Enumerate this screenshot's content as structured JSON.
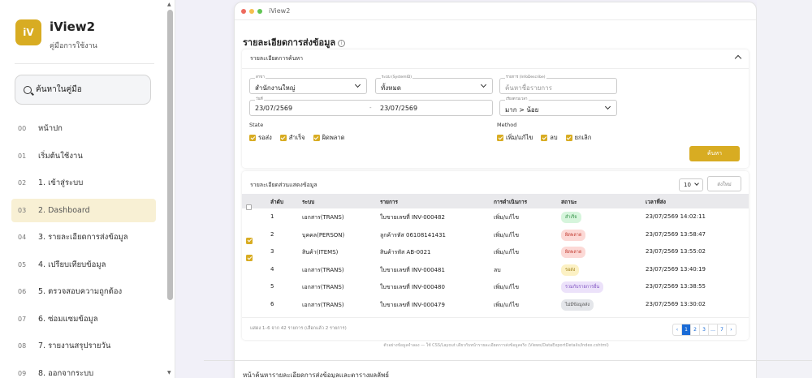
{
  "sidebar": {
    "logo_text": "iV",
    "app_name": "iView2",
    "app_subtitle": "คู่มือการใช้งาน",
    "search_placeholder": "ค้นหาในคู่มือ",
    "items": [
      {
        "num": "00",
        "label": "หน้าปก"
      },
      {
        "num": "01",
        "label": "เริ่มต้นใช้งาน"
      },
      {
        "num": "02",
        "label": "1. เข้าสู่ระบบ"
      },
      {
        "num": "03",
        "label": "2. Dashboard",
        "active": true
      },
      {
        "num": "04",
        "label": "3. รายละเอียดการส่งข้อมูล"
      },
      {
        "num": "05",
        "label": "4. เปรียบเทียบข้อมูล"
      },
      {
        "num": "06",
        "label": "5. ตรวจสอบความถูกต้อง"
      },
      {
        "num": "07",
        "label": "6. ซ่อมแซมข้อมูล"
      },
      {
        "num": "08",
        "label": "7. รายงานสรุปรายวัน"
      },
      {
        "num": "09",
        "label": "8. ออกจากระบบ"
      }
    ]
  },
  "window": {
    "title": "iView2",
    "dots": [
      "#ed6a5e",
      "#f5bf4f",
      "#61c554"
    ]
  },
  "page": {
    "title": "รายละเอียดการส่งข้อมูล",
    "info_icon": "i"
  },
  "filter": {
    "card_title": "รายละเอียดการค้นหา",
    "branch": {
      "label": "สาขา",
      "value": "สำนักงานใหญ่"
    },
    "system": {
      "label": "ระบบ (SystemID)",
      "value": "ทั้งหมด"
    },
    "item": {
      "label": "รายการ (InfoDescribe)",
      "placeholder": "ค้นหาชื่อรายการ"
    },
    "date": {
      "label": "วันที่",
      "from": "23/07/2569",
      "sep": "-",
      "to": "23/07/2569"
    },
    "sort": {
      "label": "เรียงตามเวลา",
      "value": "มาก > น้อย"
    },
    "state_label": "State",
    "states": [
      "รอส่ง",
      "สำเร็จ",
      "ผิดพลาด"
    ],
    "method_label": "Method",
    "methods": [
      "เพิ่ม/แก้ไข",
      "ลบ",
      "ยกเลิก"
    ],
    "search_button": "ค้นหา"
  },
  "table": {
    "title": "รายละเอียดส่วนแสดงข้อมูล",
    "page_size": "10",
    "export_button": "ส่งใหม่",
    "columns": [
      "ลำดับ",
      "ระบบ",
      "รายการ",
      "การดำเนินการ",
      "สถานะ",
      "เวลาที่ส่ง"
    ],
    "rows": [
      {
        "no": "1",
        "system": "เอกสาร(TRANS)",
        "item": "ใบขายเลขที่ INV-000482",
        "action": "เพิ่ม/แก้ไข",
        "status": "สำเร็จ",
        "status_bg": "#d6f5dc",
        "status_fg": "#2a8a3e",
        "time": "23/07/2569 14:02:11",
        "checked": false
      },
      {
        "no": "2",
        "system": "บุคคล(PERSON)",
        "item": "ลูกค้ารหัส 06108141431",
        "action": "เพิ่ม/แก้ไข",
        "status": "ผิดพลาด",
        "status_bg": "#fcd9d6",
        "status_fg": "#c23b30",
        "time": "23/07/2569 13:58:47",
        "checked": true
      },
      {
        "no": "3",
        "system": "สินค้า(ITEMS)",
        "item": "สินค้ารหัส AB-0021",
        "action": "เพิ่ม/แก้ไข",
        "status": "ผิดพลาด",
        "status_bg": "#fcd9d6",
        "status_fg": "#c23b30",
        "time": "23/07/2569 13:55:02",
        "checked": true
      },
      {
        "no": "4",
        "system": "เอกสาร(TRANS)",
        "item": "ใบขายเลขที่ INV-000481",
        "action": "ลบ",
        "status": "รอส่ง",
        "status_bg": "#fcf1c4",
        "status_fg": "#9a7a10",
        "time": "23/07/2569 13:40:19",
        "checked": false
      },
      {
        "no": "5",
        "system": "เอกสาร(TRANS)",
        "item": "ใบขายเลขที่ INV-000480",
        "action": "เพิ่ม/แก้ไข",
        "status": "รวมกับรายการอื่น",
        "status_bg": "#ece2fa",
        "status_fg": "#7d4fc0",
        "time": "23/07/2569 13:38:55",
        "checked": false
      },
      {
        "no": "6",
        "system": "เอกสาร(TRANS)",
        "item": "ใบขายเลขที่ INV-000479",
        "action": "เพิ่ม/แก้ไข",
        "status": "ไม่มีข้อมูลส่ง",
        "status_bg": "#e4e6ea",
        "status_fg": "#555555",
        "time": "23/07/2569 13:30:02",
        "checked": false
      }
    ],
    "summary": "แสดง 1–6 จาก 42 รายการ (เลือกแล้ว 2 รายการ)",
    "pager": [
      "‹",
      "1",
      "2",
      "3",
      "…",
      "7",
      "›"
    ]
  },
  "footnote": "ตัวอย่างข้อมูลจำลอง — ใช้ CSS/Layout เดียวกับหน้ารายละเอียดการส่งข้อมูลจริง (Views/DataExportDetails/Index.cshtml)",
  "bottom_text": "หน้าค้นหารายละเอียดการส่งข้อมูลและตารางผลลัพธ์"
}
